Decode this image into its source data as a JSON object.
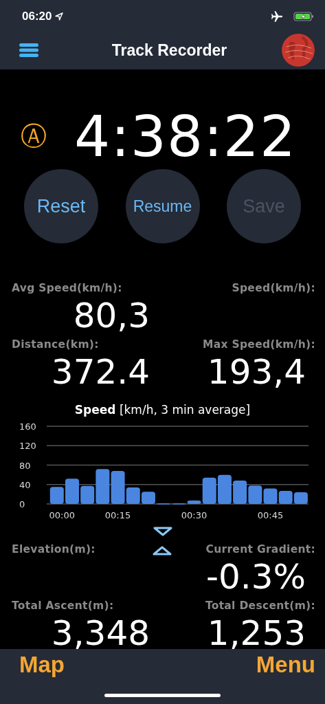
{
  "status_bar": {
    "time": "06:20"
  },
  "nav": {
    "title": "Track Recorder"
  },
  "timer": {
    "mode_badge": "Ⓐ",
    "elapsed": "4:38:22"
  },
  "buttons": [
    {
      "label": "Reset",
      "disabled": false
    },
    {
      "label": "Resume",
      "disabled": false
    },
    {
      "label": "Save",
      "disabled": true
    }
  ],
  "stats_top": [
    {
      "label": "Avg Speed(km/h):",
      "value": "80,3"
    },
    {
      "label": "Speed(km/h):"
    },
    {
      "label": "Distance(km):",
      "value": "372.4"
    },
    {
      "label": "Max Speed(km/h):",
      "value": "193,4"
    }
  ],
  "chart": {
    "chart_data": {
      "type": "bar",
      "title": "[km/h, 3 min average]",
      "grid": true,
      "x": [
        3,
        6,
        9,
        12,
        15,
        18,
        21,
        24,
        27,
        30,
        33,
        36,
        39,
        42,
        45,
        48,
        51
      ],
      "series": [
        {
          "name": "Speed",
          "color": "#4a86e0",
          "values": [
            35,
            52,
            37,
            72,
            68,
            34,
            25,
            1,
            1,
            7,
            54,
            60,
            48,
            38,
            32,
            27,
            24
          ]
        }
      ],
      "xlim": [
        1,
        52.5
      ],
      "ylim": [
        0,
        160
      ],
      "yticks": [
        0,
        40,
        80,
        120,
        160
      ],
      "xticks": [
        {
          "value": 4,
          "label": "00:00"
        },
        {
          "value": 15,
          "label": "00:15"
        },
        {
          "value": 30,
          "label": "00:30"
        },
        {
          "value": 45,
          "label": "00:45"
        }
      ]
    }
  },
  "stats_bottom": [
    {
      "label": "Elevation(m):"
    },
    {
      "label": "Current Gradient:",
      "value": "-0.3%"
    },
    {
      "label": "Total Ascent(m):",
      "value": "3,348"
    },
    {
      "label": "Total Descent(m):",
      "value": "1,253"
    }
  ],
  "tab_bar": {
    "left": "Map",
    "right": "Menu"
  }
}
